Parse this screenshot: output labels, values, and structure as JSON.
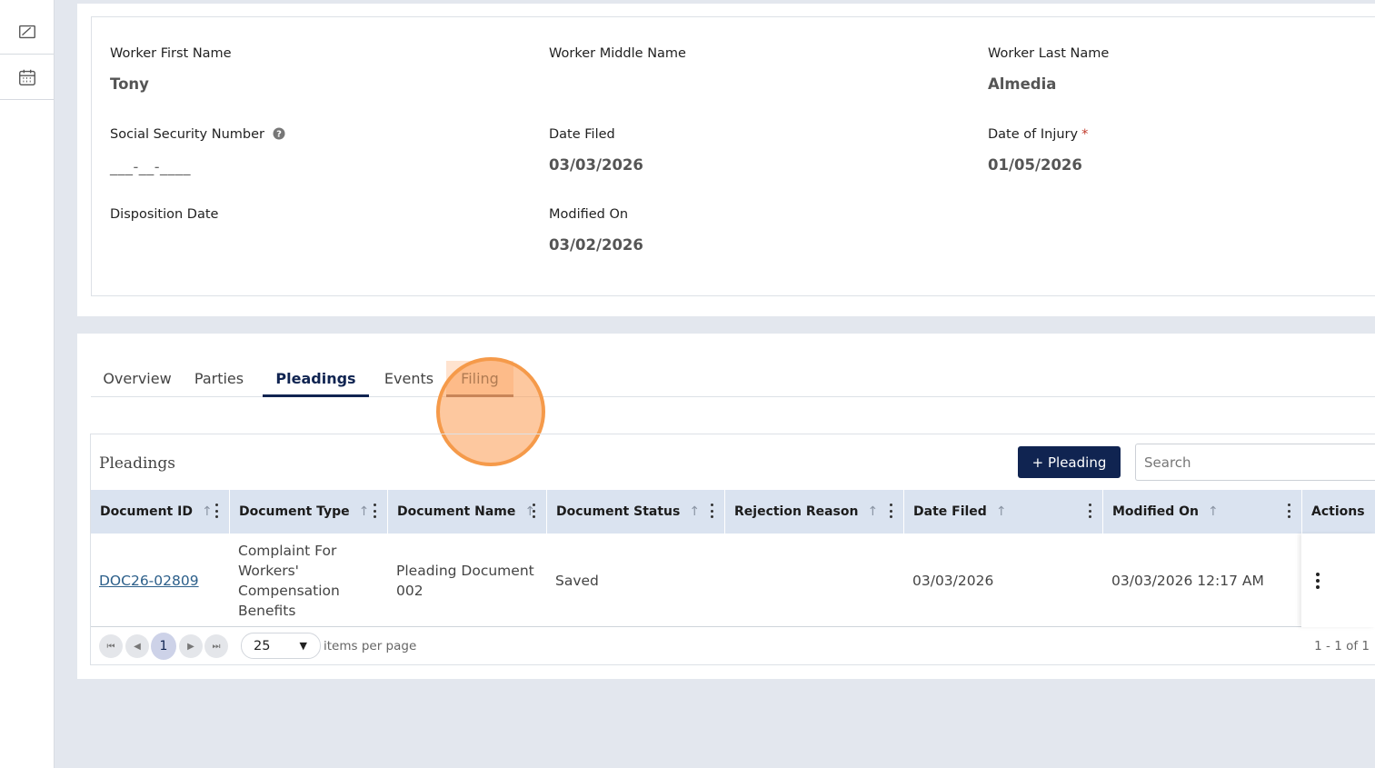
{
  "rail": {
    "icons": [
      "edit-note-icon",
      "calendar-icon"
    ]
  },
  "worker": {
    "first_name_label": "Worker First Name",
    "first_name": "Tony",
    "middle_name_label": "Worker Middle Name",
    "middle_name": "",
    "last_name_label": "Worker Last Name",
    "last_name": "Almedia",
    "ssn_label": "Social Security Number",
    "ssn_value": "___-__-____",
    "date_filed_label": "Date Filed",
    "date_filed": "03/03/2026",
    "date_of_injury_label": "Date of Injury",
    "required_mark": "*",
    "date_of_injury": "01/05/2026",
    "disposition_date_label": "Disposition Date",
    "disposition_date": "",
    "modified_on_label": "Modified On",
    "modified_on": "03/02/2026"
  },
  "tabs": [
    {
      "label": "Overview"
    },
    {
      "label": "Parties"
    },
    {
      "label": "Pleadings",
      "active": true
    },
    {
      "label": "Events"
    },
    {
      "label": "Filing"
    }
  ],
  "pleadings": {
    "title": "Pleadings",
    "add_button": "+ Pleading",
    "search_placeholder": "Search",
    "columns": [
      "Document ID",
      "Document Type",
      "Document Name",
      "Document Status",
      "Rejection Reason",
      "Date Filed",
      "Modified On",
      "Actions"
    ],
    "rows": [
      {
        "document_id": "DOC26-02809",
        "document_type": "Complaint For Workers' Compensation Benefits",
        "document_name": "Pleading Document 002",
        "document_status": "Saved",
        "rejection_reason": "",
        "date_filed": "03/03/2026",
        "modified_on": "03/03/2026 12:17 AM"
      }
    ],
    "pager": {
      "current_page": "1",
      "page_size": "25",
      "page_size_label": "items per page",
      "range_text": "1 - 1 of 1"
    }
  },
  "colors": {
    "primary": "#102451",
    "header_bg": "#dae3f0",
    "page_bg": "#e3e7ee",
    "link": "#2c5f8a",
    "click_marker": "#f59a4a"
  }
}
